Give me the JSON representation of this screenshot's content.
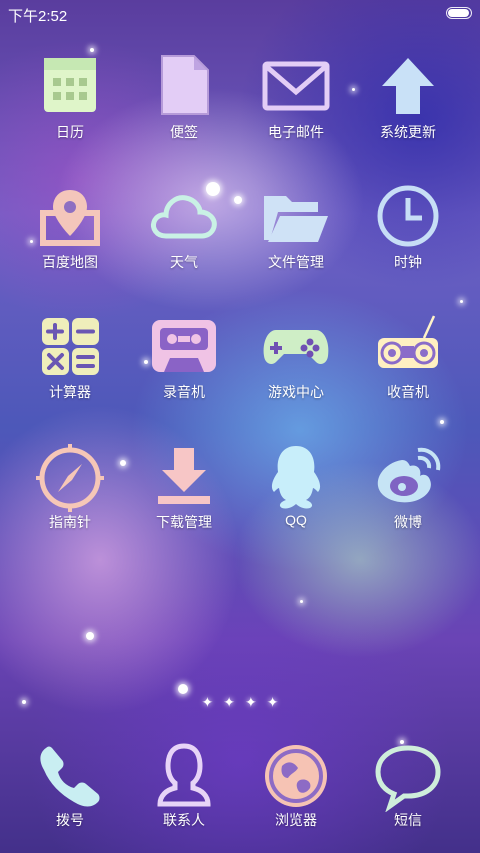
{
  "status_bar": {
    "time": "下午2:52",
    "battery_level": 1.0
  },
  "apps": [
    {
      "id": "calendar",
      "label": "日历",
      "icon": "calendar-icon"
    },
    {
      "id": "notes",
      "label": "便签",
      "icon": "note-icon"
    },
    {
      "id": "email",
      "label": "电子邮件",
      "icon": "envelope-icon"
    },
    {
      "id": "update",
      "label": "系统更新",
      "icon": "arrow-up-icon"
    },
    {
      "id": "maps",
      "label": "百度地图",
      "icon": "map-pin-icon"
    },
    {
      "id": "weather",
      "label": "天气",
      "icon": "cloud-icon"
    },
    {
      "id": "files",
      "label": "文件管理",
      "icon": "folder-icon"
    },
    {
      "id": "clock",
      "label": "时钟",
      "icon": "clock-icon"
    },
    {
      "id": "calculator",
      "label": "计算器",
      "icon": "calculator-icon"
    },
    {
      "id": "recorder",
      "label": "录音机",
      "icon": "cassette-icon"
    },
    {
      "id": "games",
      "label": "游戏中心",
      "icon": "gamepad-icon"
    },
    {
      "id": "radio",
      "label": "收音机",
      "icon": "radio-icon"
    },
    {
      "id": "compass",
      "label": "指南针",
      "icon": "compass-icon"
    },
    {
      "id": "downloads",
      "label": "下载管理",
      "icon": "download-icon"
    },
    {
      "id": "qq",
      "label": "QQ",
      "icon": "qq-penguin-icon"
    },
    {
      "id": "weibo",
      "label": "微博",
      "icon": "weibo-icon"
    }
  ],
  "page_indicator": {
    "count": 4,
    "symbol": "✦"
  },
  "dock": [
    {
      "id": "dialer",
      "label": "拨号",
      "icon": "phone-icon"
    },
    {
      "id": "contacts",
      "label": "联系人",
      "icon": "contact-icon"
    },
    {
      "id": "browser",
      "label": "浏览器",
      "icon": "globe-icon"
    },
    {
      "id": "messages",
      "label": "短信",
      "icon": "speech-bubble-icon"
    }
  ],
  "colors": {
    "mint": "#d8f5c8",
    "lavender": "#d9c4f3",
    "sky": "#cfe3f7",
    "blue": "#c7def6",
    "peach": "#f7c9b8",
    "pink": "#f3c2e0",
    "teal": "#c7f1e6",
    "lilac": "#e7d1f5"
  }
}
